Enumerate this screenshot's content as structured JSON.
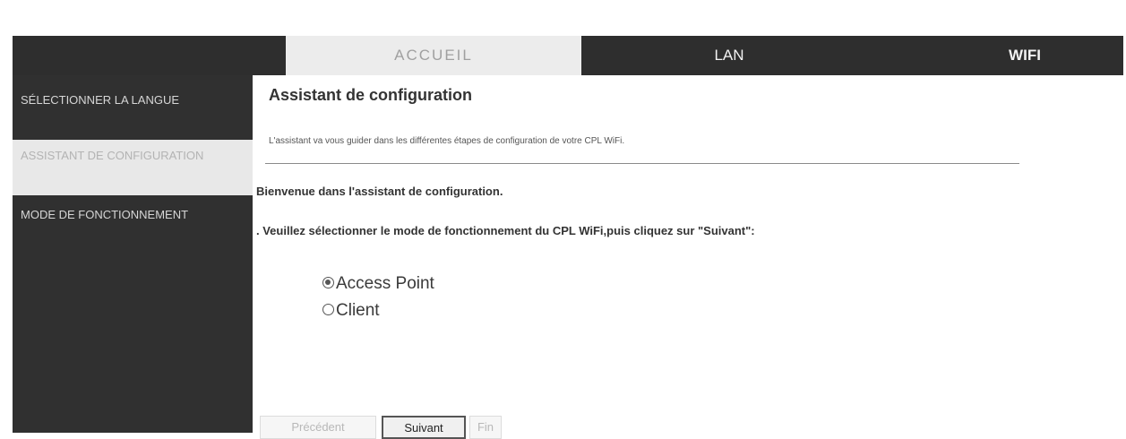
{
  "nav": {
    "tabs": [
      {
        "label": "ACCUEIL",
        "active": true
      },
      {
        "label": "LAN",
        "active": false
      },
      {
        "label": "WIFI",
        "active": false
      }
    ]
  },
  "sidebar": {
    "items": [
      {
        "label": "Sélectionner la langue"
      },
      {
        "label": "Assistant de configuration",
        "active": true
      },
      {
        "label": "Mode de fonctionnement"
      }
    ]
  },
  "main": {
    "title": "Assistant de configuration",
    "intro": "L'assistant va vous guider dans les différentes étapes de configuration de votre CPL WiFi.",
    "welcome": "Bienvenue dans l'assistant de configuration.",
    "instruction": ". Veuillez sélectionner le mode de fonctionnement du CPL WiFi,puis cliquez sur \"Suivant\":",
    "options": [
      {
        "label": "Access Point",
        "checked": true
      },
      {
        "label": "Client",
        "checked": false
      }
    ],
    "buttons": {
      "prev": "Précédent",
      "next": "Suivant",
      "finish": "Fin"
    }
  }
}
